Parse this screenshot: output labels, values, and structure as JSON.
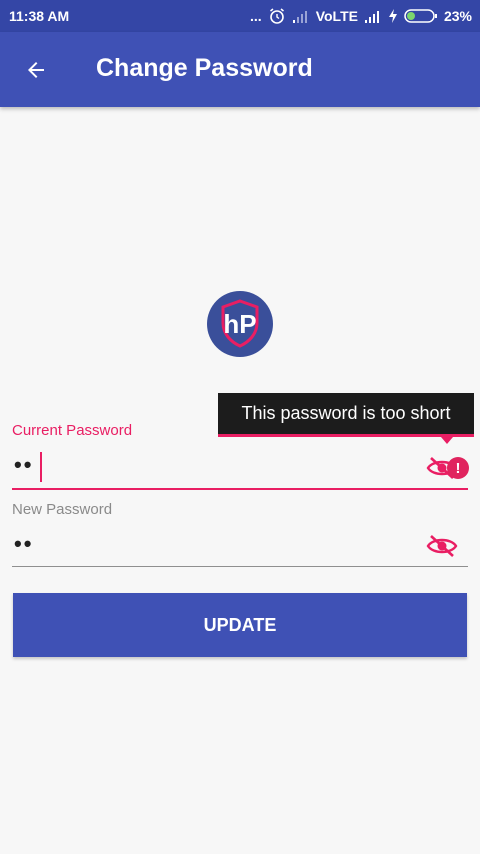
{
  "status_bar": {
    "time": "11:38 AM",
    "more": "...",
    "network": "VoLTE",
    "battery": "23%",
    "icons": [
      "alarm-icon",
      "signal-weak-icon",
      "signal-icon",
      "charging-icon",
      "battery-icon"
    ]
  },
  "app_bar": {
    "title": "Change Password",
    "back_icon": "arrow-back-icon"
  },
  "logo": {
    "letters": "hP",
    "icon": "shield-icon"
  },
  "form": {
    "current_password": {
      "label": "Current Password",
      "value": "••",
      "toggle_icon": "eye-off-icon",
      "error_tooltip": "This password is too short",
      "error_icon": "!"
    },
    "new_password": {
      "label": "New Password",
      "value": "••",
      "toggle_icon": "eye-off-icon"
    },
    "submit_label": "UPDATE"
  },
  "colors": {
    "primary": "#3f51b5",
    "status_bar": "#3446a6",
    "accent": "#e91e63",
    "tooltip_bg": "#1c1c1c"
  }
}
